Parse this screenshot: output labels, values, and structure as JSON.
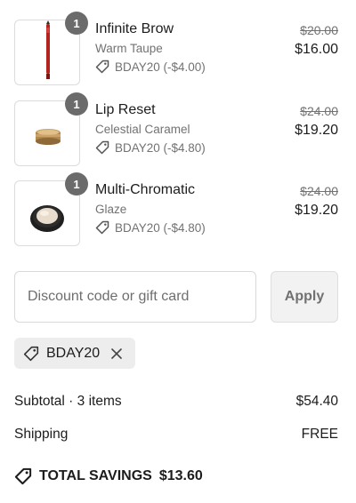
{
  "items": [
    {
      "name": "Infinite Brow",
      "variant": "Warm Taupe",
      "discount": "BDAY20 (-$4.00)",
      "original_price": "$20.00",
      "price": "$16.00",
      "quantity": "1",
      "image": "brow-pencil"
    },
    {
      "name": "Lip Reset",
      "variant": "Celestial Caramel",
      "discount": "BDAY20 (-$4.80)",
      "original_price": "$24.00",
      "price": "$19.20",
      "quantity": "1",
      "image": "lip-balm-jar"
    },
    {
      "name": "Multi-Chromatic",
      "variant": "Glaze",
      "discount": "BDAY20 (-$4.80)",
      "original_price": "$24.00",
      "price": "$19.20",
      "quantity": "1",
      "image": "compact-highlighter"
    }
  ],
  "discount_form": {
    "placeholder": "Discount code or gift card",
    "apply_label": "Apply"
  },
  "applied_code": {
    "label": "BDAY20",
    "icon": "tag-icon",
    "remove_icon": "close-icon"
  },
  "summary": {
    "subtotal_label": "Subtotal · 3 items",
    "subtotal_value": "$54.40",
    "shipping_label": "Shipping",
    "shipping_value": "FREE",
    "savings_label": "TOTAL SAVINGS",
    "savings_value": "$13.60"
  },
  "colors": {
    "text": "#1c1c1c",
    "muted": "#727272",
    "badge": "#6b6b6b",
    "chip_bg": "#ededed",
    "button_bg": "#f2f2f2"
  }
}
